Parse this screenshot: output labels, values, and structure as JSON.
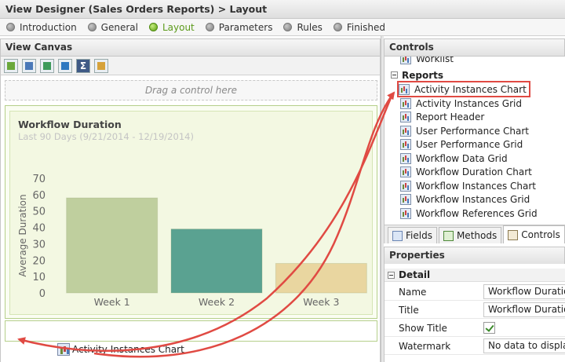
{
  "window": {
    "title": "View Designer (Sales Orders Reports) > Layout"
  },
  "steps": [
    {
      "label": "Introduction",
      "active": false
    },
    {
      "label": "General",
      "active": false
    },
    {
      "label": "Layout",
      "active": true
    },
    {
      "label": "Parameters",
      "active": false
    },
    {
      "label": "Rules",
      "active": false
    },
    {
      "label": "Finished",
      "active": false
    }
  ],
  "view_canvas": {
    "title": "View Canvas",
    "toolbar_icons": [
      "add-row-icon",
      "edit-layout-icon",
      "upload-icon",
      "export-icon",
      "sigma-icon",
      "properties-icon"
    ],
    "drop_hint": "Drag a control here",
    "chart_title": "Workflow Duration",
    "chart_subtitle": "Last 90 Days (9/21/2014 - 12/19/2014)",
    "dragging_label": "Activity Instances Chart"
  },
  "chart_data": {
    "type": "bar",
    "title": "Workflow Duration",
    "subtitle": "Last 90 Days (9/21/2014 - 12/19/2014)",
    "categories": [
      "Week 1",
      "Week 2",
      "Week 3"
    ],
    "values": [
      58,
      39,
      18
    ],
    "colors": [
      "#bfcf9e",
      "#5aa291",
      "#e9d6a0"
    ],
    "ylabel": "Average Duration",
    "xlabel": "",
    "ylim": [
      0,
      70
    ],
    "yticks": [
      0,
      10,
      20,
      30,
      40,
      50,
      60,
      70
    ]
  },
  "controls": {
    "title": "Controls",
    "cut_item": "Worklist",
    "group_label": "Reports",
    "items": [
      {
        "label": "Activity Instances Chart",
        "selected": true
      },
      {
        "label": "Activity Instances Grid",
        "selected": false
      },
      {
        "label": "Report Header",
        "selected": false
      },
      {
        "label": "User Performance Chart",
        "selected": false
      },
      {
        "label": "User Performance Grid",
        "selected": false
      },
      {
        "label": "Workflow Data Grid",
        "selected": false
      },
      {
        "label": "Workflow Duration Chart",
        "selected": false
      },
      {
        "label": "Workflow Instances Chart",
        "selected": false
      },
      {
        "label": "Workflow Instances Grid",
        "selected": false
      },
      {
        "label": "Workflow References Grid",
        "selected": false
      }
    ],
    "tabs": [
      {
        "label": "Fields",
        "active": false
      },
      {
        "label": "Methods",
        "active": false
      },
      {
        "label": "Controls",
        "active": true
      }
    ]
  },
  "properties": {
    "title": "Properties",
    "section": "Detail",
    "rows": [
      {
        "label": "Name",
        "value": "Workflow Duration"
      },
      {
        "label": "Title",
        "value": "Workflow Duration"
      },
      {
        "label": "Show Title",
        "value": "",
        "checked": true
      },
      {
        "label": "Watermark",
        "value": "No data to display"
      }
    ]
  },
  "colors": {
    "accent_green": "#5b9a1a",
    "highlight_red": "#e04a43"
  }
}
